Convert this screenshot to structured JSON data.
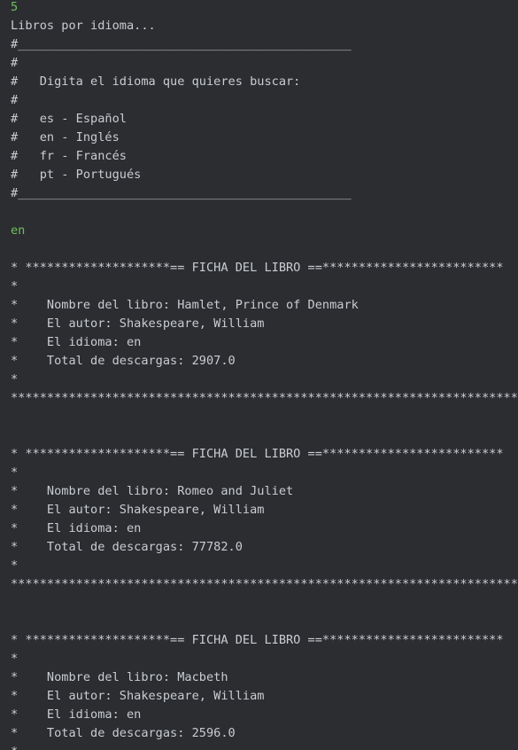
{
  "console": {
    "lines": [
      {
        "text": "5",
        "type": "input"
      },
      {
        "text": "Libros por idioma...",
        "type": "output"
      },
      {
        "text": "#______________________________________________",
        "type": "output"
      },
      {
        "text": "#",
        "type": "output"
      },
      {
        "text": "#   Digita el idioma que quieres buscar:",
        "type": "output"
      },
      {
        "text": "#",
        "type": "output"
      },
      {
        "text": "#   es - Español",
        "type": "output"
      },
      {
        "text": "#   en - Inglés",
        "type": "output"
      },
      {
        "text": "#   fr - Francés",
        "type": "output"
      },
      {
        "text": "#   pt - Portugués",
        "type": "output"
      },
      {
        "text": "#______________________________________________",
        "type": "output"
      },
      {
        "text": "",
        "type": "blank"
      },
      {
        "text": "en",
        "type": "input"
      },
      {
        "text": "",
        "type": "blank"
      },
      {
        "text": "* ********************== FICHA DEL LIBRO ==*************************",
        "type": "output"
      },
      {
        "text": "*",
        "type": "output"
      },
      {
        "text": "*    Nombre del libro: Hamlet, Prince of Denmark",
        "type": "output"
      },
      {
        "text": "*    El autor: Shakespeare, William",
        "type": "output"
      },
      {
        "text": "*    El idioma: en",
        "type": "output"
      },
      {
        "text": "*    Total de descargas: 2907.0",
        "type": "output"
      },
      {
        "text": "*",
        "type": "output"
      },
      {
        "text": "**********************************************************************",
        "type": "output"
      },
      {
        "text": "",
        "type": "blank"
      },
      {
        "text": "",
        "type": "blank"
      },
      {
        "text": "* ********************== FICHA DEL LIBRO ==*************************",
        "type": "output"
      },
      {
        "text": "*",
        "type": "output"
      },
      {
        "text": "*    Nombre del libro: Romeo and Juliet",
        "type": "output"
      },
      {
        "text": "*    El autor: Shakespeare, William",
        "type": "output"
      },
      {
        "text": "*    El idioma: en",
        "type": "output"
      },
      {
        "text": "*    Total de descargas: 77782.0",
        "type": "output"
      },
      {
        "text": "*",
        "type": "output"
      },
      {
        "text": "**********************************************************************",
        "type": "output"
      },
      {
        "text": "",
        "type": "blank"
      },
      {
        "text": "",
        "type": "blank"
      },
      {
        "text": "* ********************== FICHA DEL LIBRO ==*************************",
        "type": "output"
      },
      {
        "text": "*",
        "type": "output"
      },
      {
        "text": "*    Nombre del libro: Macbeth",
        "type": "output"
      },
      {
        "text": "*    El autor: Shakespeare, William",
        "type": "output"
      },
      {
        "text": "*    El idioma: en",
        "type": "output"
      },
      {
        "text": "*    Total de descargas: 2596.0",
        "type": "output"
      },
      {
        "text": "*",
        "type": "output"
      }
    ]
  },
  "colors": {
    "background": "#2b2d31",
    "output_text": "#c9ccd1",
    "input_text": "#6fbf5f"
  }
}
